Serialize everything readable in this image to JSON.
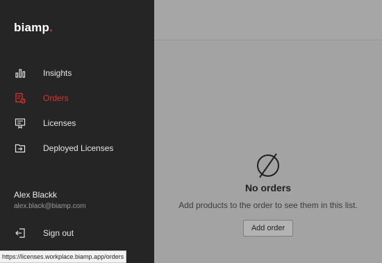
{
  "brand": {
    "logo_text": "biamp",
    "logo_dot": ".",
    "accent_color": "#e0312f"
  },
  "sidebar": {
    "items": [
      {
        "label": "Insights",
        "icon": "bar-chart-icon",
        "active": false
      },
      {
        "label": "Orders",
        "icon": "orders-icon",
        "active": true
      },
      {
        "label": "Licenses",
        "icon": "license-certificate-icon",
        "active": false
      },
      {
        "label": "Deployed Licenses",
        "icon": "folder-deploy-icon",
        "active": false
      }
    ],
    "user": {
      "name": "Alex Blackk",
      "email": "alex.black@biamp.com"
    },
    "sign_out": {
      "label": "Sign out",
      "icon": "sign-out-icon"
    }
  },
  "main": {
    "empty_state": {
      "icon": "empty-set-icon",
      "title": "No orders",
      "subtitle": "Add products to the order to see them in this list.",
      "button_label": "Add order"
    }
  },
  "status_bar": {
    "url": "https://licenses.workplace.biamp.app/orders"
  }
}
